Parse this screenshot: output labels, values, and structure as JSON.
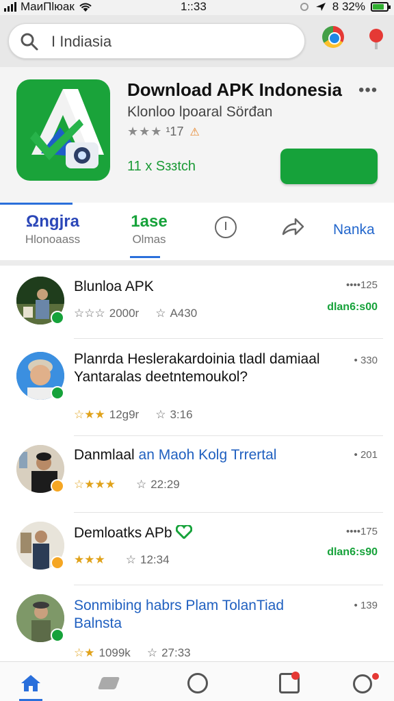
{
  "status_bar": {
    "carrier": "MaиΠlюaк",
    "time": "1::33",
    "battery": "8 32%"
  },
  "search": {
    "value": "I Indiasia"
  },
  "app": {
    "title": "Download APK Indonesia",
    "subtitle": "Klonloo lpoaral Sörđan",
    "stars": "★★★",
    "rating": "¹17",
    "size_text": "11 x Sззtсh",
    "accent": "#16a23a"
  },
  "tabs": {
    "tab1_main": "Ωngjra",
    "tab1_sub": "Hlonoaass",
    "tab2_main": "1ase",
    "tab2_sub": "Olmas",
    "link": "Nanka"
  },
  "items": [
    {
      "title": "Blunloa APK",
      "stars": "☆☆☆",
      "count": "2000r",
      "count2": "A430",
      "time": "••••125",
      "tag": "dlan6:s00",
      "badge_color": "#16a23a"
    },
    {
      "title": "Planrda Heslerakardoinia tladl damiaal",
      "title2": "Yantaralas deetntemoukol?",
      "stars": "☆★★",
      "count": "12g9r",
      "count2": "3:16",
      "time": "• 330",
      "badge_color": "#16a23a"
    },
    {
      "title": "Danmlaal ",
      "title_accent": "an Maoh Kolg Trrertal",
      "stars": "☆★★★",
      "count": "",
      "count2": "22:29",
      "time": "• 201",
      "badge_color": "#f5a623"
    },
    {
      "title": "Demloatks APb",
      "stars": "★★★",
      "count": "",
      "count2": "12:34",
      "time": "••••175",
      "tag": "dlan6:s90",
      "badge_color": "#f5a623"
    },
    {
      "title": "Sonmibing habrs",
      "title_accent": " Plam TolanTiad",
      "title2": "Balnsta",
      "stars": "☆★",
      "count": "1099k",
      "count2": "27:33",
      "time": "• 139",
      "badge_color": "#16a23a"
    }
  ]
}
